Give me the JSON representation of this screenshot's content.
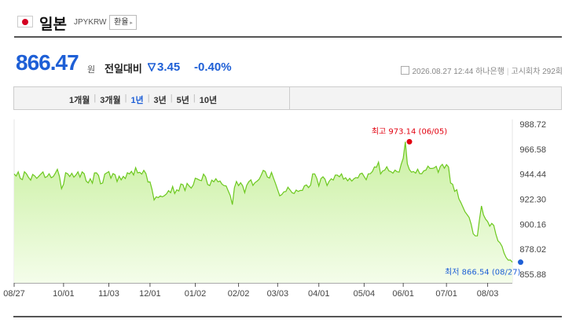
{
  "header": {
    "country": "일본",
    "code": "JPYKRW",
    "exchange_button": "환율",
    "flag_icon": "japan-flag-icon",
    "chevron_icon": "chevron-right-icon"
  },
  "quote": {
    "price": "866.47",
    "unit": "원",
    "compare_label": "전일대비",
    "change": "3.45",
    "change_pct": "-0.40%",
    "down_icon": "triangle-down-icon",
    "datetime": "2026.08.27 12:44",
    "bank": "하나은행",
    "notice": "고시회차 292회",
    "notice_icon": "document-icon"
  },
  "period_tabs": [
    "1개월",
    "3개월",
    "1년",
    "3년",
    "5년",
    "10년"
  ],
  "selected_tab": 2,
  "colors": {
    "accent": "#1e5fd6",
    "line": "#6cc81e",
    "fill_top": "#c9f0a0",
    "high": "#e2000f"
  },
  "chart_data": {
    "type": "area",
    "title": "",
    "xlabel": "",
    "ylabel": "",
    "ylim": [
      855.88,
      988.72
    ],
    "y_ticks": [
      "988.72",
      "966.58",
      "944.44",
      "922.30",
      "900.16",
      "878.02",
      "855.88"
    ],
    "x_ticks": [
      "08/27",
      "10/01",
      "11/03",
      "12/01",
      "01/02",
      "02/02",
      "03/03",
      "04/01",
      "05/04",
      "06/01",
      "07/01",
      "08/03"
    ],
    "x_tick_index": [
      0,
      24,
      46,
      66,
      88,
      109,
      128,
      148,
      170,
      189,
      210,
      230
    ],
    "high": {
      "label": "최고 973.14 (06/05)",
      "value": 973.14,
      "index": 192
    },
    "low": {
      "label": "최저 866.54 (08/27)",
      "value": 866.54,
      "index": 246
    },
    "values": [
      944.6,
      942.8,
      946.5,
      940.6,
      939.6,
      946.6,
      944.7,
      941.6,
      939.1,
      944.2,
      942.9,
      940.7,
      942.6,
      944.6,
      946.4,
      941.5,
      942.3,
      944.8,
      941.3,
      942.3,
      945.3,
      948.7,
      942.6,
      931.6,
      935.6,
      945.7,
      944.8,
      942.3,
      945.2,
      941.8,
      943.7,
      946.5,
      941.8,
      946.4,
      944.9,
      938.3,
      936.7,
      940.4,
      936.5,
      945.5,
      945.6,
      943.3,
      935.9,
      936.7,
      944.5,
      945.6,
      946.7,
      940.9,
      944.9,
      944.0,
      937.9,
      942.7,
      939.4,
      942.5,
      940.5,
      945.7,
      944.7,
      946.9,
      943.7,
      950.2,
      945.6,
      946.1,
      944.5,
      947.8,
      945.0,
      937.5,
      937.6,
      930.8,
      921.6,
      924.4,
      923.7,
      925.2,
      924.4,
      925.4,
      927.0,
      929.9,
      928.0,
      933.6,
      927.3,
      930.6,
      929.5,
      935.7,
      935.1,
      930.0,
      936.3,
      934.0,
      932.1,
      934.8,
      940.9,
      940.2,
      939.2,
      938.7,
      944.5,
      942.0,
      935.3,
      934.3,
      939.1,
      937.7,
      940.4,
      937.7,
      938.4,
      935.5,
      934.3,
      934.0,
      929.5,
      925.3,
      917.5,
      932.4,
      938.0,
      934.3,
      936.9,
      934.2,
      928.1,
      934.7,
      937.8,
      939.4,
      934.5,
      937.0,
      938.2,
      940.0,
      943.6,
      947.8,
      946.8,
      942.0,
      941.0,
      946.0,
      940.9,
      936.0,
      930.7,
      925.3,
      926.3,
      928.8,
      929.1,
      932.9,
      930.5,
      928.1,
      927.3,
      930.4,
      929.1,
      930.1,
      930.0,
      934.1,
      934.9,
      932.5,
      934.8,
      944.7,
      944.7,
      940.8,
      934.0,
      940.5,
      942.1,
      940.0,
      934.4,
      938.1,
      940.4,
      939.3,
      943.6,
      943.6,
      942.1,
      944.7,
      940.0,
      941.3,
      938.6,
      940.7,
      938.3,
      940.3,
      941.4,
      941.1,
      944.6,
      945.3,
      942.3,
      939.5,
      944.7,
      944.8,
      946.8,
      950.9,
      950.6,
      955.1,
      944.6,
      947.3,
      948.0,
      951.0,
      947.4,
      946.7,
      945.3,
      948.0,
      946.6,
      946.2,
      953.1,
      958.5,
      973.14,
      953.5,
      948.5,
      946.2,
      946.8,
      945.4,
      948.8,
      945.0,
      944.8,
      947.4,
      948.0,
      951.6,
      949.5,
      949.5,
      950.0,
      951.4,
      946.0,
      951.2,
      953.2,
      949.7,
      952.9,
      950.8,
      936.6,
      935.5,
      929.2,
      930.7,
      922.8,
      919.3,
      915.3,
      911.2,
      908.7,
      906.1,
      900.1,
      891.7,
      889.8,
      889.8,
      904.0,
      916.3,
      908.4,
      904.7,
      902.4,
      898.4,
      900.9,
      899.1,
      891.5,
      885.4,
      883.6,
      880.5,
      874.6,
      870.7,
      868.3,
      868.5,
      866.54
    ]
  }
}
